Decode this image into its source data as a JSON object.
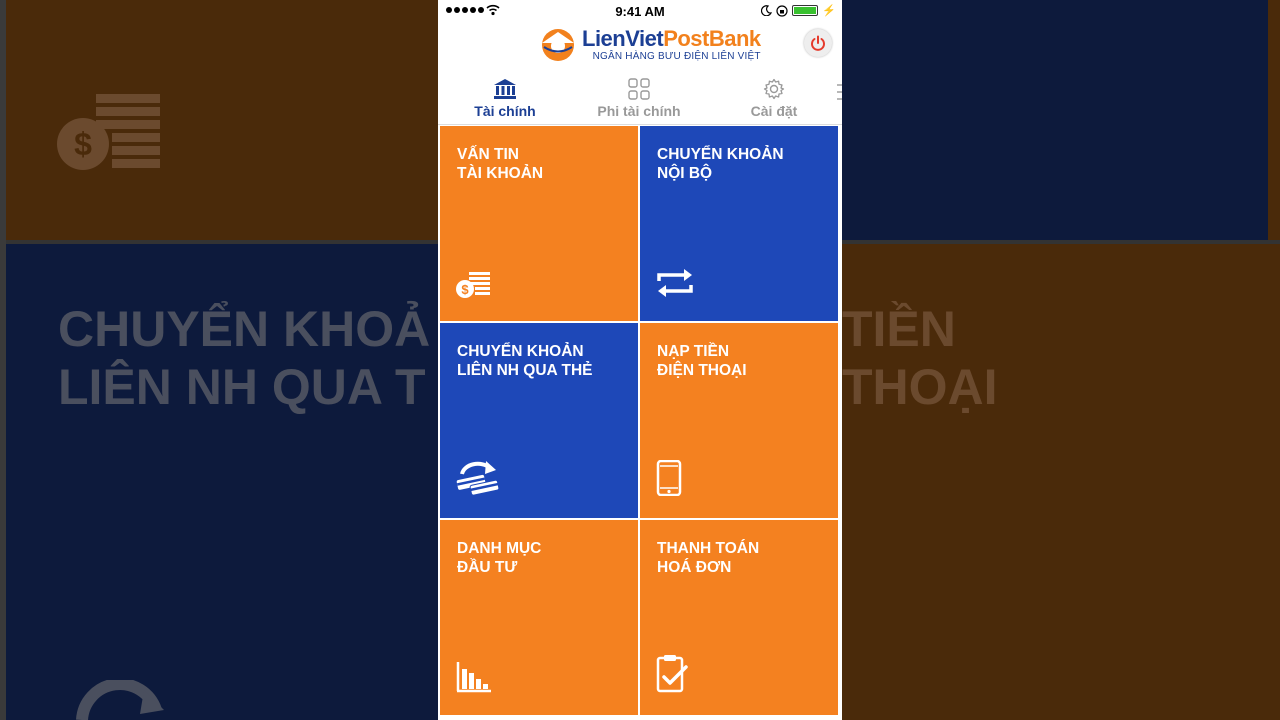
{
  "background": {
    "text_left_line1": "CHUYỂN KHOẢ",
    "text_left_line2": "LIÊN NH QUA T",
    "text_right_line1": "TIỀN",
    "text_right_line2": "THOẠI"
  },
  "statusbar": {
    "time": "9:41 AM",
    "signal_dots": 5,
    "battery_percent": 100
  },
  "header": {
    "logo_part1": "Lien",
    "logo_part2": "Viet",
    "logo_part3": "PostBank",
    "logo_subtitle": "NGÂN HÀNG BƯU ĐIỆN LIÊN VIỆT"
  },
  "tabs": [
    {
      "label": "Tài chính",
      "icon": "bank-icon",
      "active": true
    },
    {
      "label": "Phi tài chính",
      "icon": "grid-icon",
      "active": false
    },
    {
      "label": "Cài đặt",
      "icon": "gear-icon",
      "active": false
    }
  ],
  "tiles": [
    {
      "line1": "VẤN TIN",
      "line2": "TÀI KHOẢN",
      "color": "#f48120",
      "icon": "coins-icon"
    },
    {
      "line1": "CHUYỂN KHOẢN",
      "line2": "NỘI BỘ",
      "color": "#1e48b8",
      "icon": "transfer-arrows-icon"
    },
    {
      "line1": "CHUYỂN KHOẢN",
      "line2": "LIÊN NH QUA THẺ",
      "color": "#1e48b8",
      "icon": "card-transfer-icon"
    },
    {
      "line1": "NẠP TIỀN",
      "line2": "ĐIỆN THOẠI",
      "color": "#f48120",
      "icon": "phone-icon"
    },
    {
      "line1": "DANH MỤC",
      "line2": "ĐẦU TƯ",
      "color": "#f48120",
      "icon": "bar-chart-icon"
    },
    {
      "line1": "THANH TOÁN",
      "line2": "HOÁ ĐƠN",
      "color": "#f48120",
      "icon": "clipboard-check-icon"
    }
  ],
  "colors": {
    "brand_blue": "#1c3f94",
    "brand_orange": "#f2811d",
    "tile_orange": "#f48120",
    "tile_blue": "#1e48b8"
  }
}
